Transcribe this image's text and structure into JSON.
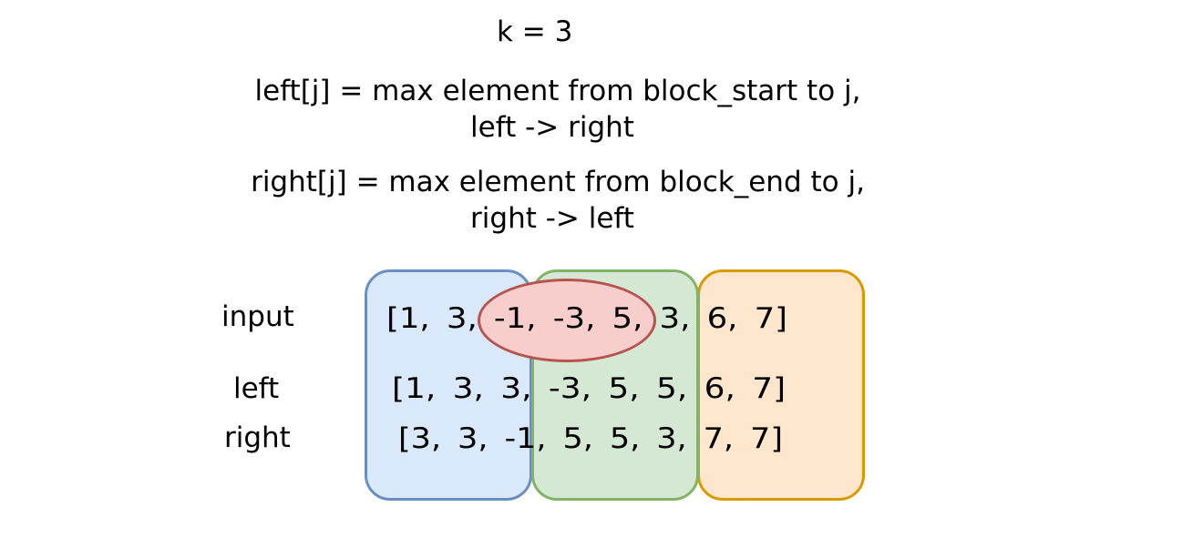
{
  "title": "k = 3",
  "definitions": {
    "left_line1": "left[j] = max element from block_start to j,",
    "left_line2": "left -> right",
    "right_line1": "right[j] = max element from block_end to j,",
    "right_line2": "right -> left"
  },
  "rows": {
    "input_label": "input",
    "input_values": "[1,  3,  -1,  -3,  5,  3,  6,  7]",
    "left_label": "left",
    "left_values": "[1,  3,  3,  -3,  5,  5,  6,  7]",
    "right_label": "right",
    "right_values": "[3,  3, -1,  5,  5,  3,  7,  7]"
  },
  "colors": {
    "block1_fill": "#dae8fc",
    "block1_border": "#6c8ebf",
    "block2_fill": "#d5e8d4",
    "block2_border": "#82b366",
    "block3_fill": "#ffe6cc",
    "block3_border": "#d79b00",
    "window_fill": "#f8cecc",
    "window_border": "#b85450"
  }
}
